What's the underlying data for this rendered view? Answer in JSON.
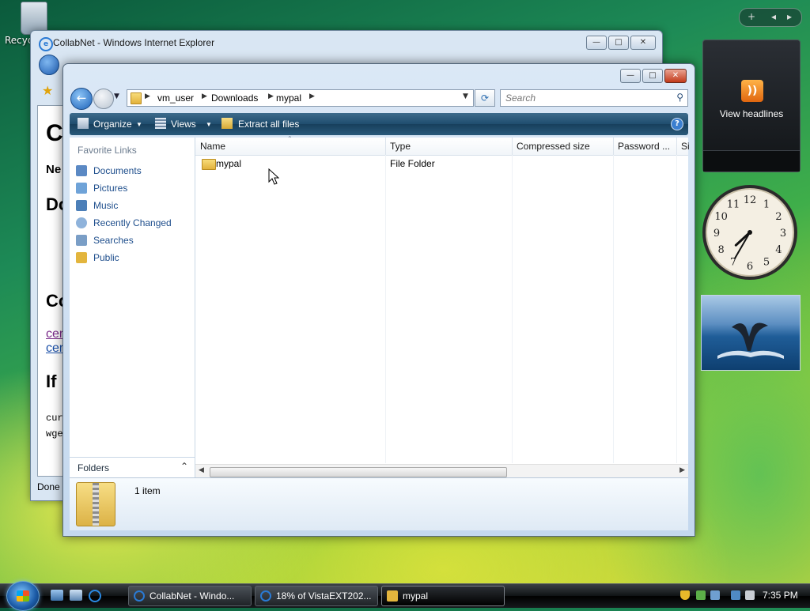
{
  "desktop": {
    "recycle_bin_label": "Recyc",
    "sidebar": {
      "feed_label": "View headlines",
      "controls": {
        "add": "+",
        "prev": "◂",
        "next": "▸"
      }
    },
    "clock": {
      "time": "7:35",
      "numbers": [
        "12",
        "1",
        "2",
        "3",
        "4",
        "5",
        "6",
        "7",
        "8",
        "9",
        "10",
        "11"
      ]
    }
  },
  "ie_window": {
    "title": "CollabNet - Windows Internet Explorer",
    "status": "Done",
    "content_fragments": [
      {
        "text": "C",
        "style": "h1"
      },
      {
        "text": "Ne",
        "style": "h3"
      },
      {
        "text": "Do",
        "style": "h2"
      },
      {
        "text": "Co",
        "style": "h2"
      },
      {
        "text": "cer",
        "style": "link-visited"
      },
      {
        "text": "cer",
        "style": "link"
      },
      {
        "text": "If",
        "style": "h2"
      },
      {
        "text": "cur",
        "style": "mono"
      },
      {
        "text": "wge",
        "style": "mono"
      }
    ]
  },
  "explorer": {
    "title_buttons": {
      "minimize": "—",
      "maximize": "□",
      "close": "✕"
    },
    "breadcrumb": [
      "vm_user",
      "Downloads",
      "mypal"
    ],
    "search_placeholder": "Search",
    "toolbar": {
      "organize": "Organize",
      "views": "Views",
      "extract": "Extract all files",
      "help": "?"
    },
    "nav_pane": {
      "header": "Favorite Links",
      "links": [
        {
          "label": "Documents",
          "color": "#5b89c4"
        },
        {
          "label": "Pictures",
          "color": "#6fa3d8"
        },
        {
          "label": "Music",
          "color": "#4c7fb8"
        },
        {
          "label": "Recently Changed",
          "color": "#8fb3db"
        },
        {
          "label": "Searches",
          "color": "#7a9ec6"
        },
        {
          "label": "Public",
          "color": "#e3b53d"
        }
      ],
      "folders_label": "Folders"
    },
    "columns": [
      "Name",
      "Type",
      "Compressed size",
      "Password ...",
      "Si"
    ],
    "files": [
      {
        "name": "mypal",
        "type": "File Folder",
        "compressed_size": "",
        "password": "",
        "size": ""
      }
    ],
    "details": {
      "item_count": "1 item"
    }
  },
  "taskbar": {
    "tasks": [
      {
        "label": "CollabNet - Windo...",
        "icon_color": "#2a7ad4"
      },
      {
        "label": "18% of VistaEXT202...",
        "icon_color": "#2a7ad4"
      },
      {
        "label": "mypal",
        "icon_color": "#e3b53d"
      }
    ],
    "clock": "7:35 PM"
  }
}
